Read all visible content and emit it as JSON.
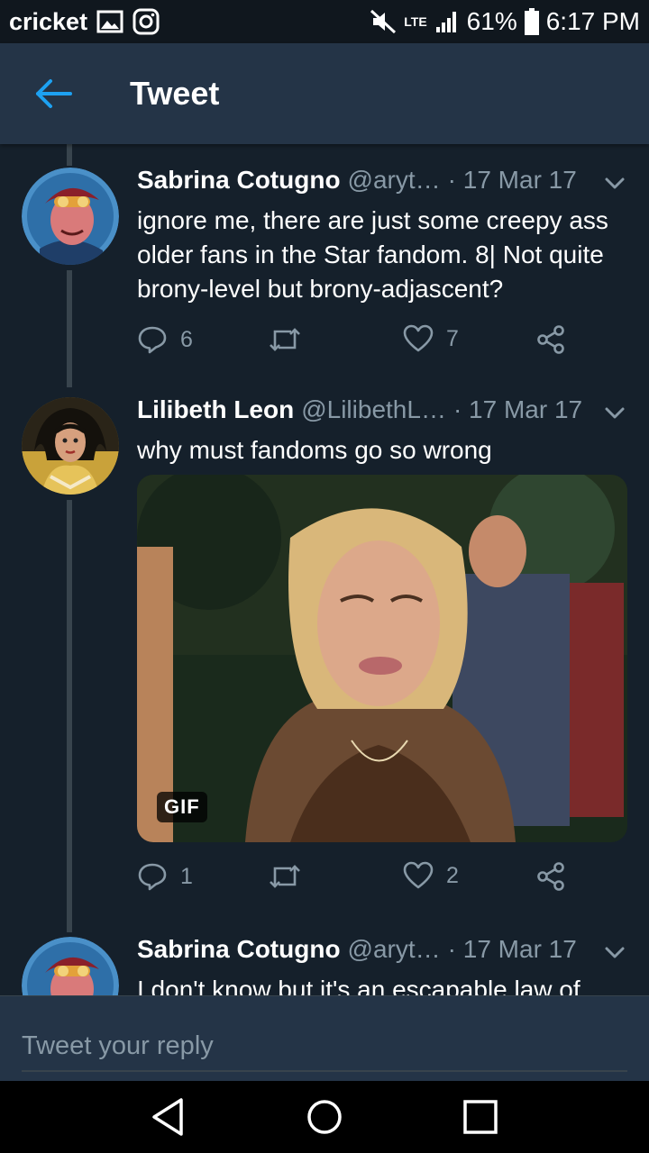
{
  "status_bar": {
    "carrier": "cricket",
    "network": "LTE",
    "battery": "61%",
    "time": "6:17 PM",
    "icons": [
      "image-icon",
      "instagram-icon",
      "mute-icon",
      "signal-icon",
      "battery-icon"
    ]
  },
  "header": {
    "title": "Tweet",
    "accent": "#1da1f2"
  },
  "tweets": [
    {
      "name": "Sabrina Cotugno",
      "handle": "@aryt…",
      "date": "· 17 Mar 17",
      "text": "ignore me, there are just some creepy ass older fans in the Star fandom. 8| Not quite brony-level but brony-adjascent?",
      "replies": "6",
      "likes": "7"
    },
    {
      "name": "Lilibeth Leon",
      "handle": "@LilibethL…",
      "date": "· 17 Mar 17",
      "text": "why must fandoms go so wrong",
      "media_badge": "GIF",
      "replies": "1",
      "likes": "2"
    },
    {
      "name": "Sabrina Cotugno",
      "handle": "@aryt…",
      "date": "· 17 Mar 17",
      "text": "I don't know but it's an escapable law of"
    }
  ],
  "reply": {
    "placeholder": "Tweet your reply"
  },
  "colors": {
    "background": "#15202b",
    "header_bg": "#243447",
    "muted_text": "#8899a6",
    "thread_line": "#38444d"
  }
}
